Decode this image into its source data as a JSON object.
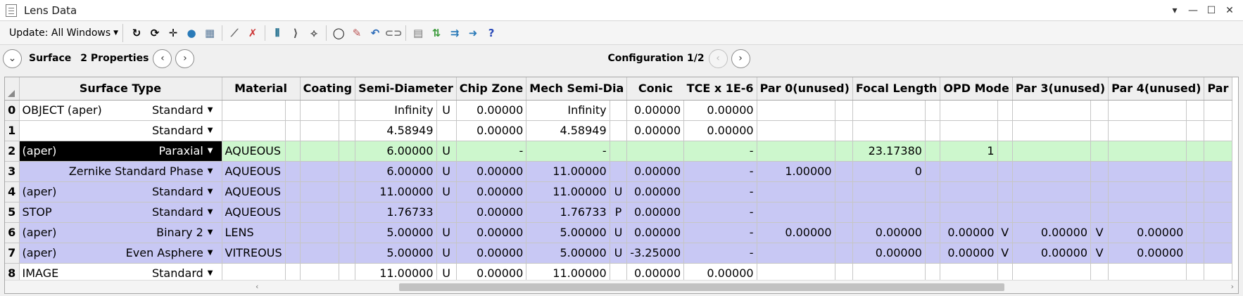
{
  "window": {
    "title": "Lens Data"
  },
  "toolbar": {
    "update_label": "Update: All Windows"
  },
  "nav": {
    "section_label": "Surface",
    "properties_label": "2 Properties",
    "configuration_label": "Configuration 1/2"
  },
  "columns": {
    "surface_type": "Surface Type",
    "material": "Material",
    "coating": "Coating",
    "semi_diameter": "Semi-Diameter",
    "chip_zone": "Chip Zone",
    "mech_semi_dia": "Mech Semi-Dia",
    "conic": "Conic",
    "tce": "TCE x 1E-6",
    "par0": "Par 0(unused)",
    "focal_length": "Focal Length",
    "opd_mode": "OPD Mode",
    "par3": "Par 3(unused)",
    "par4": "Par 4(unused)",
    "par5": "Par"
  },
  "rows": [
    {
      "num": "0",
      "comment": "OBJECT (aper)",
      "type": "Standard",
      "material": "",
      "semi": "Infinity",
      "semi_f": "U",
      "chip": "0.00000",
      "mech": "Infinity",
      "mech_f": "",
      "conic": "0.00000",
      "tce": "0.00000",
      "p0": "",
      "p1": "",
      "p2": "",
      "p2_f": "",
      "p3": "",
      "p3_f": "",
      "p4": ""
    },
    {
      "num": "1",
      "comment": "",
      "type": "Standard",
      "material": "",
      "semi": "4.58949",
      "semi_f": "",
      "chip": "0.00000",
      "mech": "4.58949",
      "mech_f": "",
      "conic": "0.00000",
      "tce": "0.00000",
      "p0": "",
      "p1": "",
      "p2": "",
      "p2_f": "",
      "p3": "",
      "p3_f": "",
      "p4": ""
    },
    {
      "num": "2",
      "comment": "(aper)",
      "type": "Paraxial",
      "material": "AQUEOUS",
      "semi": "6.00000",
      "semi_f": "U",
      "chip": "-",
      "mech": "-",
      "mech_f": "",
      "conic": "",
      "tce": "-",
      "p0": "",
      "p1": "23.17380",
      "p2": "1",
      "p2_f": "",
      "p3": "",
      "p3_f": "",
      "p4": ""
    },
    {
      "num": "3",
      "comment": "",
      "type": "Zernike Standard Phase",
      "material": "AQUEOUS",
      "semi": "6.00000",
      "semi_f": "U",
      "chip": "0.00000",
      "mech": "11.00000",
      "mech_f": "",
      "conic": "0.00000",
      "tce": "-",
      "p0": "1.00000",
      "p1": "0",
      "p2": "",
      "p2_f": "",
      "p3": "",
      "p3_f": "",
      "p4": ""
    },
    {
      "num": "4",
      "comment": "(aper)",
      "type": "Standard",
      "material": "AQUEOUS",
      "semi": "11.00000",
      "semi_f": "U",
      "chip": "0.00000",
      "mech": "11.00000",
      "mech_f": "U",
      "conic": "0.00000",
      "tce": "-",
      "p0": "",
      "p1": "",
      "p2": "",
      "p2_f": "",
      "p3": "",
      "p3_f": "",
      "p4": ""
    },
    {
      "num": "5",
      "comment": "STOP",
      "type": "Standard",
      "material": "AQUEOUS",
      "semi": "1.76733",
      "semi_f": "",
      "chip": "0.00000",
      "mech": "1.76733",
      "mech_f": "P",
      "conic": "0.00000",
      "tce": "-",
      "p0": "",
      "p1": "",
      "p2": "",
      "p2_f": "",
      "p3": "",
      "p3_f": "",
      "p4": ""
    },
    {
      "num": "6",
      "comment": "(aper)",
      "type": "Binary 2",
      "material": "LENS",
      "semi": "5.00000",
      "semi_f": "U",
      "chip": "0.00000",
      "mech": "5.00000",
      "mech_f": "U",
      "conic": "0.00000",
      "tce": "-",
      "p0": "0.00000",
      "p1": "0.00000",
      "p2": "0.00000",
      "p2_f": "V",
      "p3": "0.00000",
      "p3_f": "V",
      "p4": "0.00000"
    },
    {
      "num": "7",
      "comment": "(aper)",
      "type": "Even Asphere",
      "material": "VITREOUS",
      "semi": "5.00000",
      "semi_f": "U",
      "chip": "0.00000",
      "mech": "5.00000",
      "mech_f": "U",
      "conic": "-3.25000",
      "tce": "-",
      "p0": "",
      "p1": "0.00000",
      "p2": "0.00000",
      "p2_f": "V",
      "p3": "0.00000",
      "p3_f": "V",
      "p4": "0.00000"
    },
    {
      "num": "8",
      "comment": "IMAGE",
      "type": "Standard",
      "material": "",
      "semi": "11.00000",
      "semi_f": "U",
      "chip": "0.00000",
      "mech": "11.00000",
      "mech_f": "",
      "conic": "0.00000",
      "tce": "0.00000",
      "p0": "",
      "p1": "",
      "p2": "",
      "p2_f": "",
      "p3": "",
      "p3_f": "",
      "p4": ""
    }
  ],
  "row_colors": [
    "white",
    "white",
    "green",
    "blue",
    "blue",
    "blue",
    "blue",
    "blue",
    "white"
  ],
  "colors": {
    "green_row": "#cdf7cd",
    "blue_row": "#c8c8f4",
    "selected_cell": "#000000"
  }
}
